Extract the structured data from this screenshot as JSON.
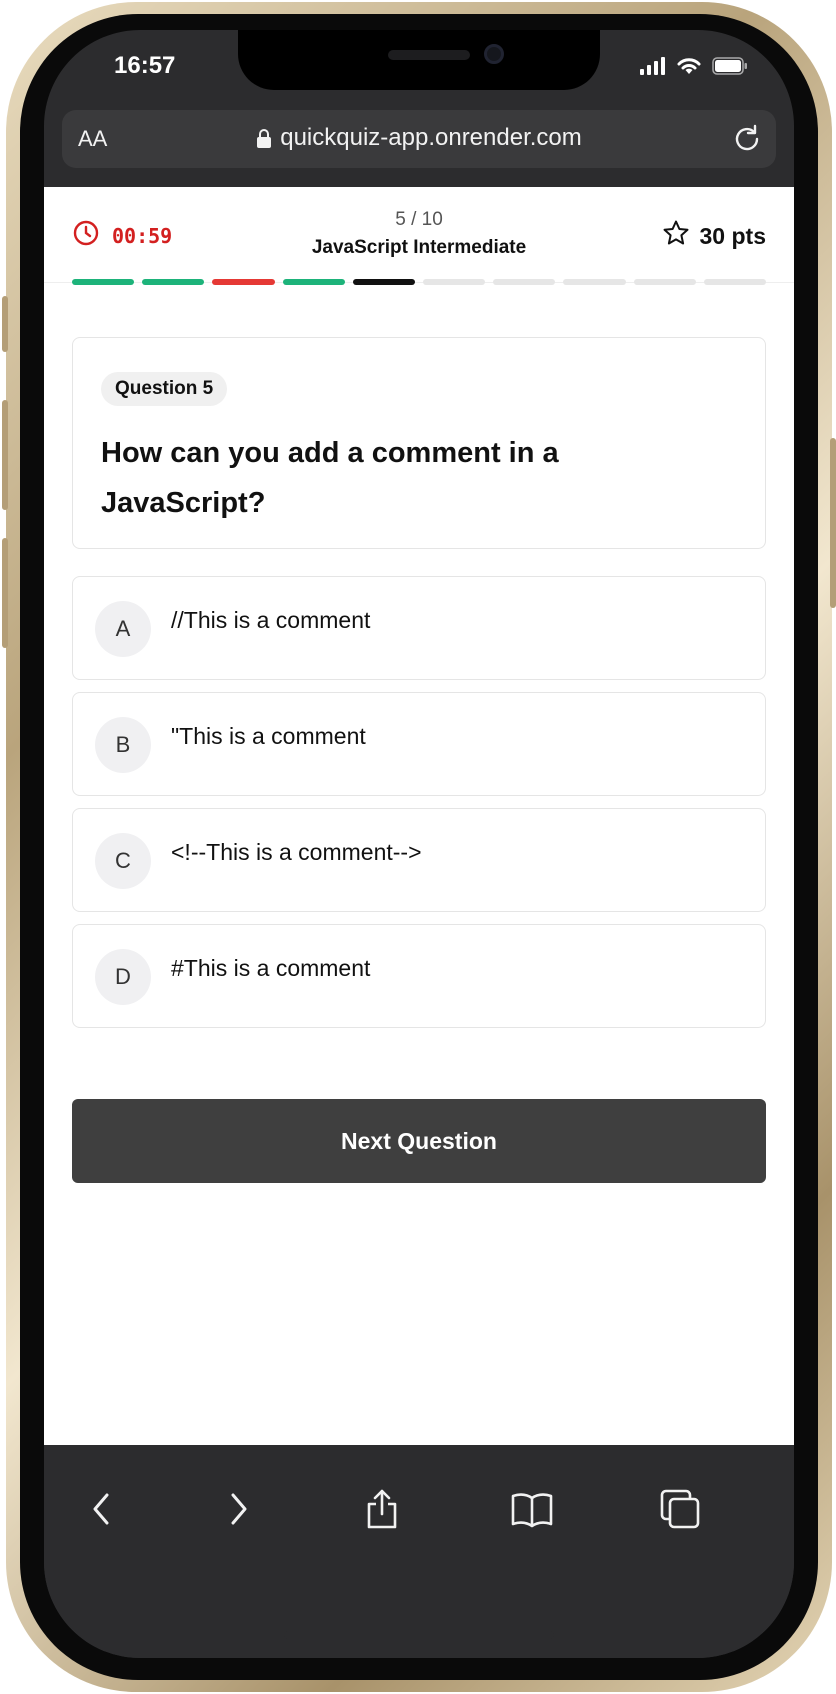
{
  "status_bar": {
    "time": "16:57"
  },
  "browser": {
    "text_size_label": "AA",
    "url": "quickquiz-app.onrender.com"
  },
  "quiz": {
    "timer": "00:59",
    "progress_text": "5 / 10",
    "title": "JavaScript Intermediate",
    "points": "30 pts",
    "progress": {
      "current": 5,
      "total": 10,
      "segment_states": [
        "correct",
        "correct",
        "wrong",
        "correct",
        "current",
        "pending",
        "pending",
        "pending",
        "pending",
        "pending"
      ]
    },
    "question": {
      "tag": "Question 5",
      "text": "How can you add a comment in a JavaScript?"
    },
    "options": [
      {
        "letter": "A",
        "text": "//This is a comment"
      },
      {
        "letter": "B",
        "text": "\"This is a comment"
      },
      {
        "letter": "C",
        "text": "<!--This is a comment-->"
      },
      {
        "letter": "D",
        "text": "#This is a comment"
      }
    ],
    "next_button": "Next Question"
  },
  "colors": {
    "correct": "#1db37a",
    "wrong": "#e53935",
    "current": "#111111",
    "pending": "#e6e6e6",
    "timer": "#d32020",
    "button": "#3f3f3f"
  }
}
